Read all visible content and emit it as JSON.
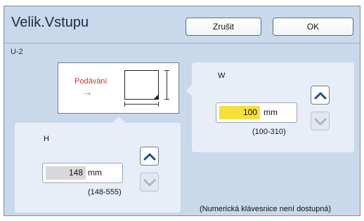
{
  "header": {
    "title": "Velik.Vstupu",
    "cancel_label": "Zrušit",
    "ok_label": "OK"
  },
  "code": "U-2",
  "preview": {
    "feed_label": "Podávání",
    "feed_arrow": "→"
  },
  "width_panel": {
    "label": "W",
    "value": "100",
    "unit": "mm",
    "range": "(100-310)",
    "up_icon": "chevron-up-icon",
    "down_icon": "chevron-down-icon"
  },
  "height_panel": {
    "label": "H",
    "value": "148",
    "unit": "mm",
    "range": "(148-555)",
    "up_icon": "chevron-up-icon",
    "down_icon": "chevron-down-icon"
  },
  "note": "(Numerická klávesnice není dostupná)",
  "colors": {
    "active_field": "#f5df3a",
    "inactive_field": "#d6d8dc",
    "enabled_arrow": "#1a4f8f",
    "disabled_arrow": "#aab6c4"
  }
}
